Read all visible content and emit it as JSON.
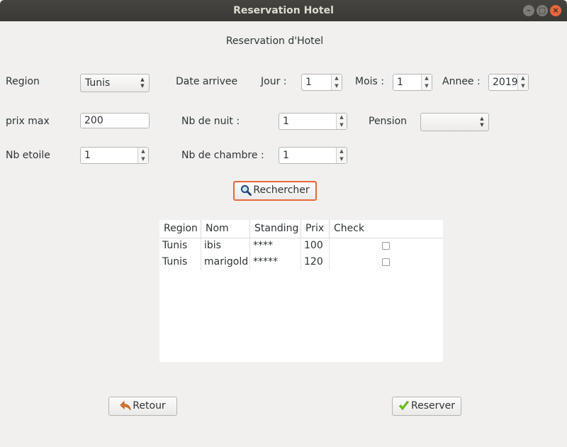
{
  "window": {
    "title": "Reservation Hotel"
  },
  "form": {
    "heading": "Reservation d'Hotel",
    "region_label": "Region",
    "region_value": "Tunis",
    "date_label": "Date arrivee",
    "jour_label": "Jour :",
    "jour_value": "1",
    "mois_label": "Mois :",
    "mois_value": "1",
    "annee_label": "Annee :",
    "annee_value": "2019",
    "prix_label": "prix max",
    "prix_value": "200",
    "nuit_label": "Nb de nuit :",
    "nuit_value": "1",
    "pension_label": "Pension",
    "pension_value": "",
    "etoile_label": "Nb etoile",
    "etoile_value": "1",
    "chambre_label": "Nb de chambre :",
    "chambre_value": "1",
    "search_label": "Rechercher"
  },
  "table": {
    "columns": [
      "Region",
      "Nom",
      "Standing",
      "Prix",
      "Check"
    ],
    "rows": [
      {
        "region": "Tunis",
        "nom": "ibis",
        "standing": "****",
        "prix": "100",
        "checked": false
      },
      {
        "region": "Tunis",
        "nom": "marigold",
        "standing": "*****",
        "prix": "120",
        "checked": false
      }
    ]
  },
  "footer": {
    "back_label": "Retour",
    "reserve_label": "Reserver"
  },
  "icons": {
    "search": "magnifier-icon",
    "back": "undo-arrow-icon",
    "reserve": "checkmark-icon"
  },
  "colors": {
    "titlebar": "#3a3935",
    "close_button": "#e8673a",
    "focus_border": "#e8673a",
    "check_green": "#4e9a06",
    "back_orange": "#e07a2e"
  }
}
